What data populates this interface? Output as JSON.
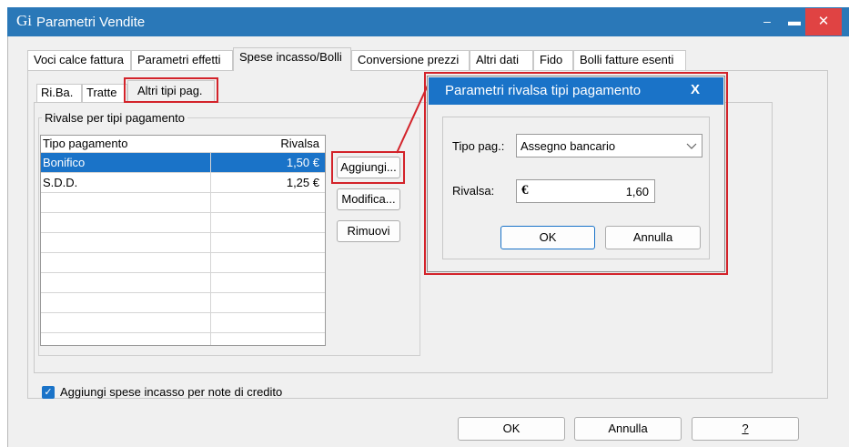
{
  "window": {
    "title": "Parametri Vendite",
    "app_icon": "Gi",
    "minimize": "‒",
    "maximize": "▬",
    "close": "✕"
  },
  "tabs": [
    "Voci calce fattura",
    "Parametri effetti",
    "Spese incasso/Bolli",
    "Conversione prezzi",
    "Altri dati",
    "Fido",
    "Bolli fatture esenti"
  ],
  "subtabs": [
    "Ri.Ba.",
    "Tratte",
    "Altri tipi pag."
  ],
  "group_label": "Rivalse per tipi pagamento",
  "table": {
    "headers": [
      "Tipo pagamento",
      "Rivalsa"
    ],
    "rows": [
      {
        "tipo": "Bonifico",
        "rivalsa": "1,50 €"
      },
      {
        "tipo": "S.D.D.",
        "rivalsa": "1,25 €"
      }
    ]
  },
  "side_buttons": {
    "add": "Aggiungi...",
    "edit": "Modifica...",
    "remove": "Rimuovi"
  },
  "checkbox": {
    "label": "Aggiungi spese incasso per note di credito",
    "checked": true,
    "mark": "✓"
  },
  "footer": {
    "ok": "OK",
    "cancel": "Annulla",
    "help": "?"
  },
  "dialog": {
    "title": "Parametri rivalsa tipi pagamento",
    "close": "X",
    "tipo_label": "Tipo pag.:",
    "tipo_value": "Assegno bancario",
    "rivalsa_label": "Rivalsa:",
    "currency": "€",
    "rivalsa_value": "1,60",
    "ok": "OK",
    "cancel": "Annulla"
  },
  "colors": {
    "titlebar": "#2a78b8",
    "accent": "#1a73c8",
    "highlight": "#d3232a",
    "close_button": "#e04343"
  }
}
